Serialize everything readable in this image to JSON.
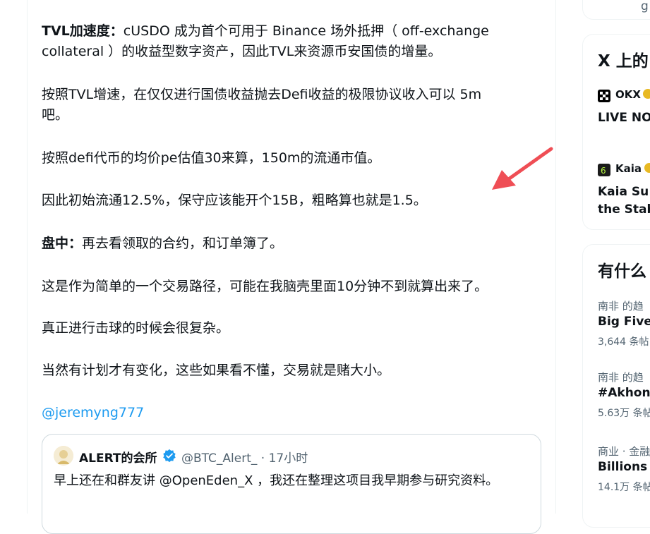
{
  "post": {
    "p1_bold": "TVL加速度：",
    "p1_line1_rest": "cUSDO 成为首个可用于 Binance 场外抵押（ off-exchange",
    "p1_line2": "collateral ）的收益型数字资产，因此TVL来资源币安国债的增量。",
    "p2_line1": "按照TVL增速，在仅仅进行国债收益抛去Defi收益的极限协议收入可以 5m",
    "p2_line2": "吧。",
    "p3": "按照defi代币的均价pe估值30来算，150m的流通市值。",
    "p4": "因此初始流通12.5%，保守应该能开个15B，粗略算也就是1.5。",
    "p5_bold": "盘中：",
    "p5_rest": "再去看领取的合约，和订单簿了。",
    "p6": "这是作为简单的一个交易路径，可能在我脑壳里面10分钟不到就算出来了。",
    "p7": "真正进行击球的时候会很复杂。",
    "p8": "当然有计划才有变化，这些如果看不懂，交易就是赌大小。",
    "mention": "@jeremyng777"
  },
  "quote": {
    "name": "ALERT的会所",
    "handle": "@BTC_Alert_ · 17小时",
    "text": "早上还在和群友讲 @OpenEden_X ，我还在整理这项目我早期参与研究资料。"
  },
  "sidebar": {
    "top_card_text": "g",
    "live_card": {
      "heading": "X 上的",
      "items": [
        {
          "account": "OKX",
          "text": "LIVE NO"
        },
        {
          "account": "Kaia",
          "text": "Kaia Su",
          "text2": "the Stab"
        }
      ]
    },
    "trends_card": {
      "heading": "有什么",
      "trends": [
        {
          "category": "南非 的趋",
          "title": "Big Five",
          "count": "3,644 条帖"
        },
        {
          "category": "南非 的趋",
          "title": "#Akhona",
          "count": "5.63万 条帖"
        },
        {
          "category": "商业 · 金融",
          "title": "Billions",
          "count": "14.1万 条帖"
        }
      ]
    }
  },
  "colors": {
    "accent": "#1d9bf0",
    "arrow": "#ef4e55",
    "verified": "#1d9bf0"
  }
}
